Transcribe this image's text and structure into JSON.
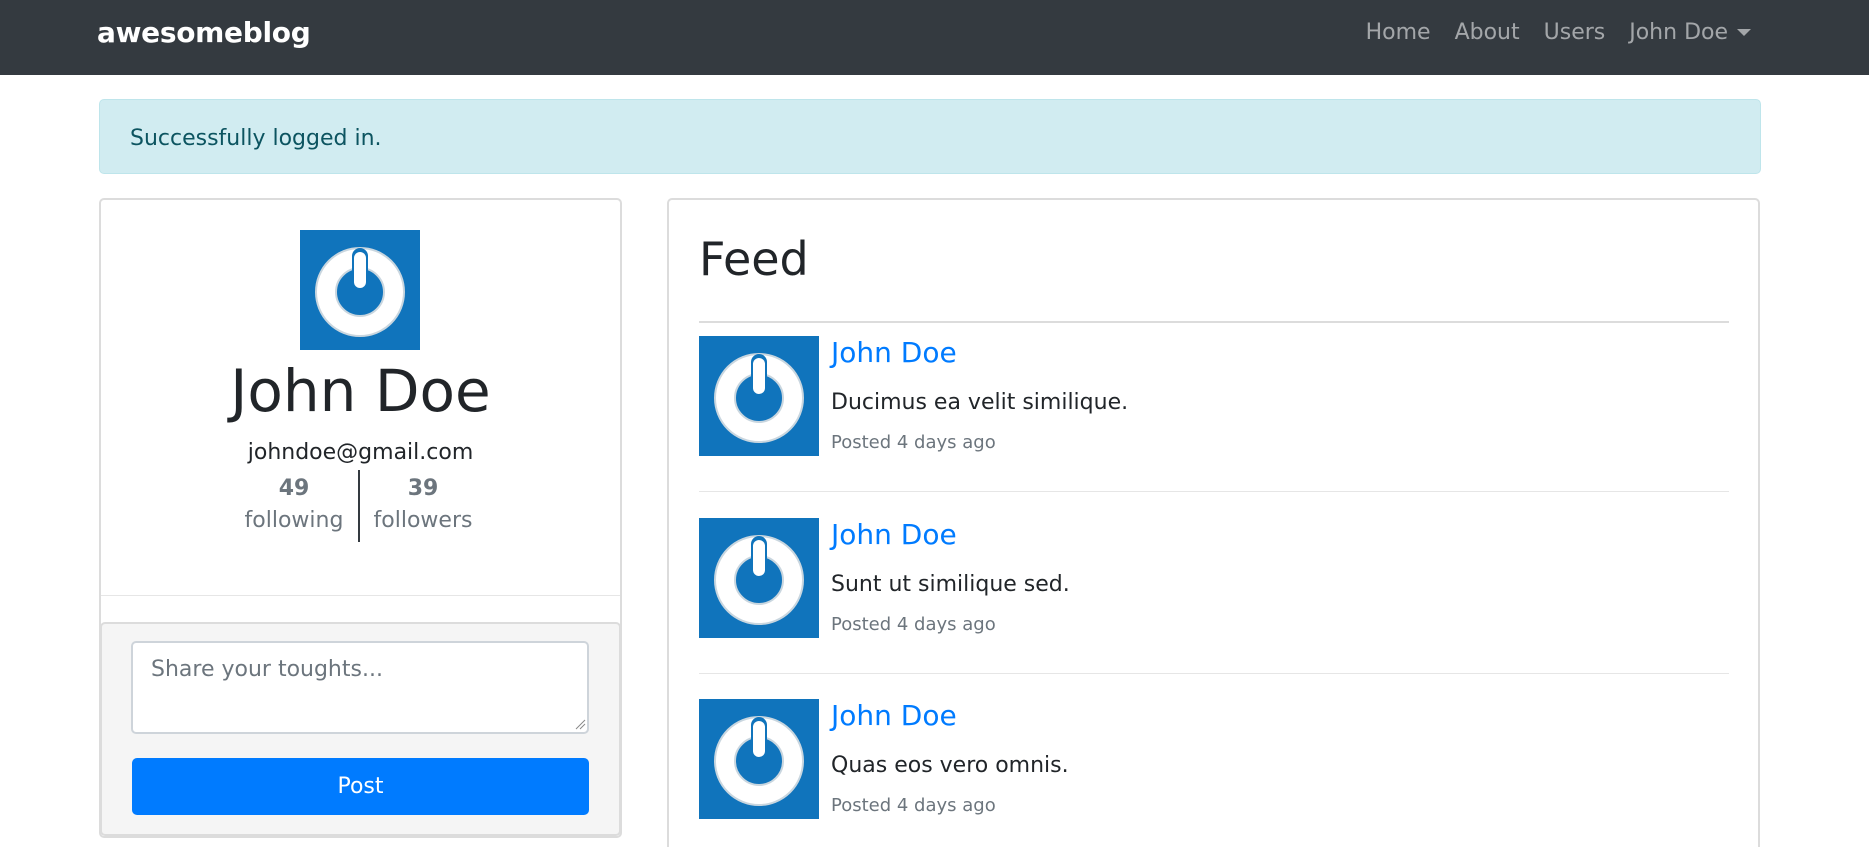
{
  "nav": {
    "brand": "awesomeblog",
    "links": [
      "Home",
      "About",
      "Users"
    ],
    "user_menu": "John Doe"
  },
  "alert": {
    "message": "Successfully logged in."
  },
  "profile": {
    "name": "John Doe",
    "email": "johndoe@gmail.com",
    "following_count": "49",
    "following_label": "following",
    "followers_count": "39",
    "followers_label": "followers"
  },
  "composer": {
    "placeholder": "Share your toughts...",
    "button_label": "Post"
  },
  "feed": {
    "title": "Feed",
    "posts": [
      {
        "author": "John Doe",
        "body": "Ducimus ea velit similique.",
        "time": "Posted 4 days ago"
      },
      {
        "author": "John Doe",
        "body": "Sunt ut similique sed.",
        "time": "Posted 4 days ago"
      },
      {
        "author": "John Doe",
        "body": "Quas eos vero omnis.",
        "time": "Posted 4 days ago"
      }
    ]
  },
  "colors": {
    "navbar": "#343a40",
    "primary": "#007bff",
    "alert_bg": "#d1ecf1",
    "avatar_bg": "#1074bc"
  },
  "icons": {
    "avatar": "power-button-gravatar-icon"
  }
}
